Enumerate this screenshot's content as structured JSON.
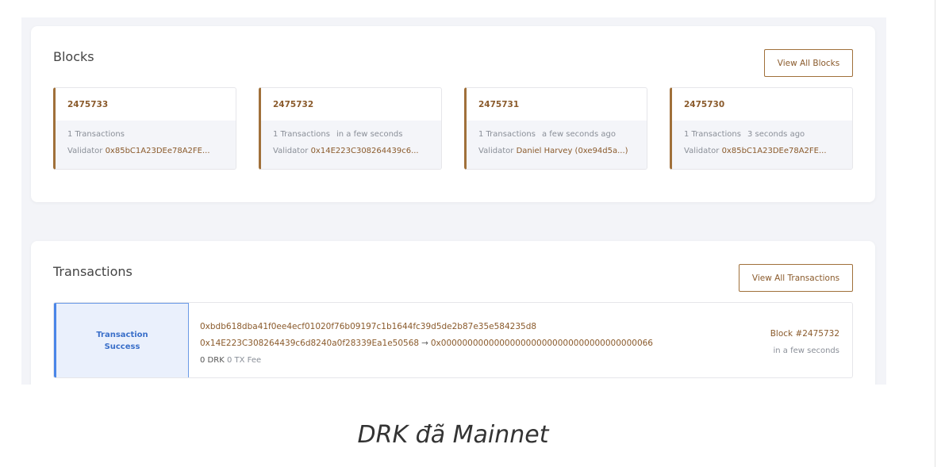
{
  "blocks": {
    "title": "Blocks",
    "view_all_label": "View All Blocks",
    "items": [
      {
        "number": "2475733",
        "transactions": "1 Transactions",
        "time": "",
        "validator_label": "Validator",
        "validator": "0x85bC1A23DEe78A2FE..."
      },
      {
        "number": "2475732",
        "transactions": "1 Transactions",
        "time": "in a few seconds",
        "validator_label": "Validator",
        "validator": "0x14E223C308264439c6..."
      },
      {
        "number": "2475731",
        "transactions": "1 Transactions",
        "time": "a few seconds ago",
        "validator_label": "Validator",
        "validator": "Daniel Harvey (0xe94d5a...)"
      },
      {
        "number": "2475730",
        "transactions": "1 Transactions",
        "time": "3 seconds ago",
        "validator_label": "Validator",
        "validator": "0x85bC1A23DEe78A2FE..."
      }
    ]
  },
  "transactions": {
    "title": "Transactions",
    "view_all_label": "View All Transactions",
    "items": [
      {
        "status_line1": "Transaction",
        "status_line2": "Success",
        "hash": "0xbdb618dba41f0ee4ecf01020f76b09197c1b1644fc39d5de2b87e35e584235d8",
        "from": "0x14E223C308264439c6d8240a0f28339Ea1e50568",
        "arrow": "→",
        "to": "0x0000000000000000000000000000000000000066",
        "amount": "0 DRK",
        "fee": "0 TX Fee",
        "block": "Block #2475732",
        "time": "in a few seconds"
      }
    ]
  },
  "caption": "DRK đã Mainnet",
  "colors": {
    "accent": "#a0703a",
    "accent_text": "#8a5a2b",
    "success_bg": "#eaf0fc",
    "success_border": "#4a86e8",
    "page_bg": "#f3f4f8"
  }
}
